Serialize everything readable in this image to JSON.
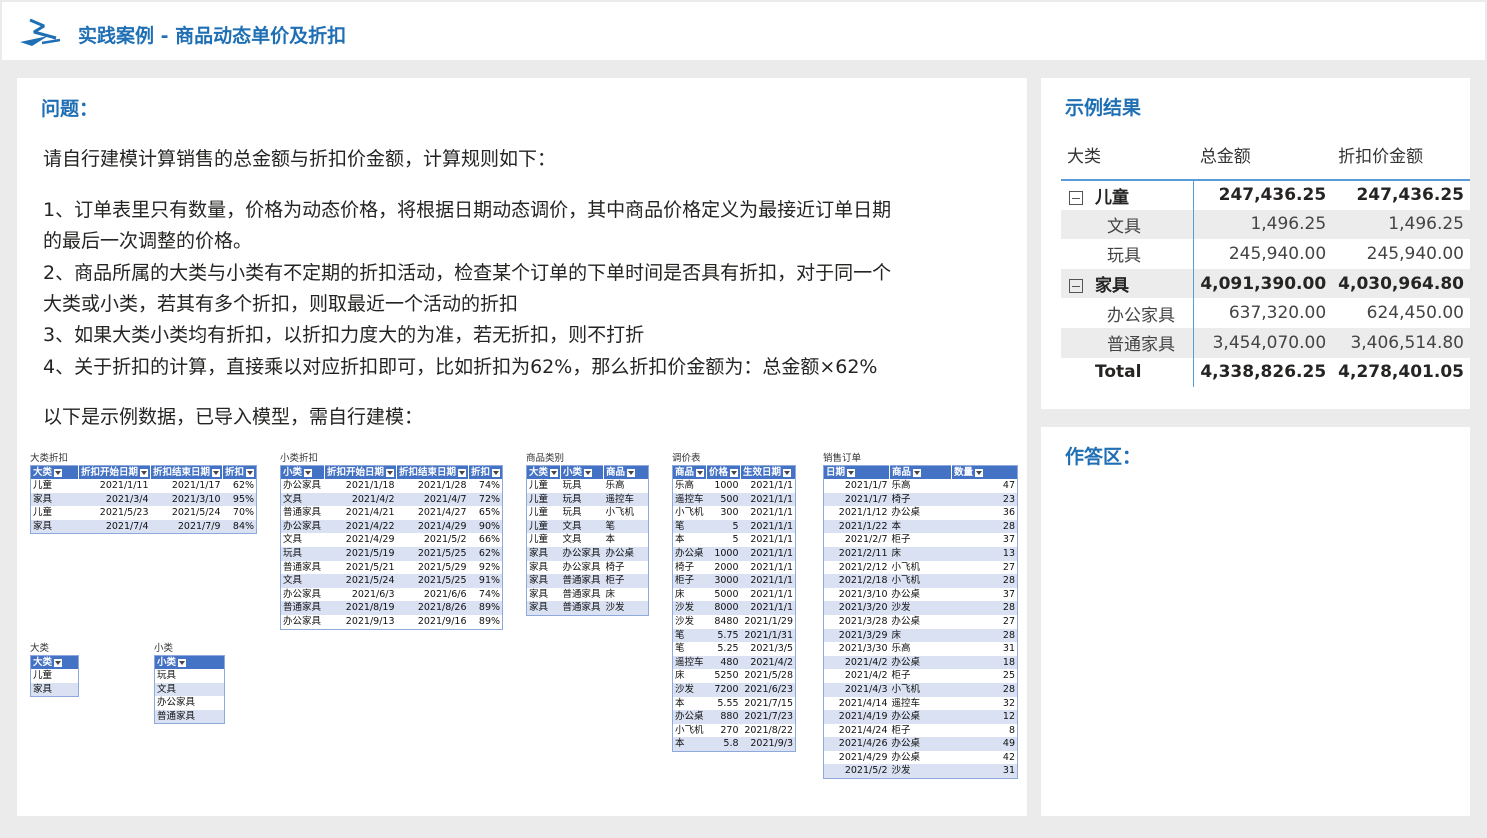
{
  "header": {
    "title": "实践案例 - 商品动态单价及折扣"
  },
  "question": {
    "heading": "问题：",
    "intro": "请自行建模计算销售的总金额与折扣价金额，计算规则如下：",
    "rules": [
      "1、订单表里只有数量，价格为动态价格，将根据日期动态调价，其中商品价格定义为最接近订单日期",
      "的最后一次调整的价格。",
      "2、商品所属的大类与小类有不定期的折扣活动，检查某个订单的下单时间是否具有折扣，对于同一个",
      "大类或小类，若其有多个折扣，则取最近一个活动的折扣",
      "3、如果大类小类均有折扣，以折扣力度大的为准，若无折扣，则不打折",
      "4、关于折扣的计算，直接乘以对应折扣即可，比如折扣为62%，那么折扣价金额为：总金额×62%"
    ],
    "data_note": "以下是示例数据，已导入模型，需自行建模："
  },
  "tables": {
    "category_discount": {
      "caption": "大类折扣",
      "headers": [
        "大类",
        "折扣开始日期",
        "折扣结束日期",
        "折扣"
      ],
      "rows": [
        [
          "儿童",
          "2021/1/11",
          "2021/1/17",
          "62%"
        ],
        [
          "家具",
          "2021/3/4",
          "2021/3/10",
          "95%"
        ],
        [
          "儿童",
          "2021/5/23",
          "2021/5/24",
          "70%"
        ],
        [
          "家具",
          "2021/7/4",
          "2021/7/9",
          "84%"
        ]
      ]
    },
    "subcategory_discount": {
      "caption": "小类折扣",
      "headers": [
        "小类",
        "折扣开始日期",
        "折扣结束日期",
        "折扣"
      ],
      "rows": [
        [
          "办公家具",
          "2021/1/18",
          "2021/1/28",
          "74%"
        ],
        [
          "文具",
          "2021/4/2",
          "2021/4/7",
          "72%"
        ],
        [
          "普通家具",
          "2021/4/21",
          "2021/4/27",
          "65%"
        ],
        [
          "办公家具",
          "2021/4/22",
          "2021/4/29",
          "90%"
        ],
        [
          "文具",
          "2021/4/29",
          "2021/5/2",
          "66%"
        ],
        [
          "玩具",
          "2021/5/19",
          "2021/5/25",
          "62%"
        ],
        [
          "普通家具",
          "2021/5/21",
          "2021/5/29",
          "92%"
        ],
        [
          "文具",
          "2021/5/24",
          "2021/5/25",
          "91%"
        ],
        [
          "办公家具",
          "2021/6/3",
          "2021/6/6",
          "74%"
        ],
        [
          "普通家具",
          "2021/8/19",
          "2021/8/26",
          "89%"
        ],
        [
          "办公家具",
          "2021/9/13",
          "2021/9/16",
          "89%"
        ]
      ]
    },
    "product_category": {
      "caption": "商品类别",
      "headers": [
        "大类",
        "小类",
        "商品"
      ],
      "rows": [
        [
          "儿童",
          "玩具",
          "乐高"
        ],
        [
          "儿童",
          "玩具",
          "遥控车"
        ],
        [
          "儿童",
          "玩具",
          "小飞机"
        ],
        [
          "儿童",
          "文具",
          "笔"
        ],
        [
          "儿童",
          "文具",
          "本"
        ],
        [
          "家具",
          "办公家具",
          "办公桌"
        ],
        [
          "家具",
          "办公家具",
          "椅子"
        ],
        [
          "家具",
          "普通家具",
          "柜子"
        ],
        [
          "家具",
          "普通家具",
          "床"
        ],
        [
          "家具",
          "普通家具",
          "沙发"
        ]
      ]
    },
    "price_adjust": {
      "caption": "调价表",
      "headers": [
        "商品",
        "价格",
        "生效日期"
      ],
      "rows": [
        [
          "乐高",
          "1000",
          "2021/1/1"
        ],
        [
          "遥控车",
          "500",
          "2021/1/1"
        ],
        [
          "小飞机",
          "300",
          "2021/1/1"
        ],
        [
          "笔",
          "5",
          "2021/1/1"
        ],
        [
          "本",
          "5",
          "2021/1/1"
        ],
        [
          "办公桌",
          "1000",
          "2021/1/1"
        ],
        [
          "椅子",
          "2000",
          "2021/1/1"
        ],
        [
          "柜子",
          "3000",
          "2021/1/1"
        ],
        [
          "床",
          "5000",
          "2021/1/1"
        ],
        [
          "沙发",
          "8000",
          "2021/1/1"
        ],
        [
          "沙发",
          "8480",
          "2021/1/29"
        ],
        [
          "笔",
          "5.75",
          "2021/1/31"
        ],
        [
          "笔",
          "5.25",
          "2021/3/5"
        ],
        [
          "遥控车",
          "480",
          "2021/4/2"
        ],
        [
          "床",
          "5250",
          "2021/5/28"
        ],
        [
          "沙发",
          "7200",
          "2021/6/23"
        ],
        [
          "本",
          "5.55",
          "2021/7/15"
        ],
        [
          "办公桌",
          "880",
          "2021/7/23"
        ],
        [
          "小飞机",
          "270",
          "2021/8/22"
        ],
        [
          "本",
          "5.8",
          "2021/9/3"
        ]
      ]
    },
    "sales_orders": {
      "caption": "销售订单",
      "headers": [
        "日期",
        "商品",
        "数量"
      ],
      "rows": [
        [
          "2021/1/7",
          "乐高",
          "47"
        ],
        [
          "2021/1/7",
          "椅子",
          "23"
        ],
        [
          "2021/1/12",
          "办公桌",
          "36"
        ],
        [
          "2021/1/22",
          "本",
          "28"
        ],
        [
          "2021/2/7",
          "柜子",
          "37"
        ],
        [
          "2021/2/11",
          "床",
          "13"
        ],
        [
          "2021/2/12",
          "小飞机",
          "27"
        ],
        [
          "2021/2/18",
          "小飞机",
          "28"
        ],
        [
          "2021/3/10",
          "办公桌",
          "37"
        ],
        [
          "2021/3/20",
          "沙发",
          "28"
        ],
        [
          "2021/3/28",
          "办公桌",
          "27"
        ],
        [
          "2021/3/29",
          "床",
          "28"
        ],
        [
          "2021/3/30",
          "乐高",
          "31"
        ],
        [
          "2021/4/2",
          "办公桌",
          "18"
        ],
        [
          "2021/4/2",
          "柜子",
          "25"
        ],
        [
          "2021/4/3",
          "小飞机",
          "28"
        ],
        [
          "2021/4/14",
          "遥控车",
          "32"
        ],
        [
          "2021/4/19",
          "办公桌",
          "12"
        ],
        [
          "2021/4/24",
          "柜子",
          "8"
        ],
        [
          "2021/4/26",
          "办公桌",
          "49"
        ],
        [
          "2021/4/29",
          "办公桌",
          "42"
        ],
        [
          "2021/5/2",
          "沙发",
          "31"
        ]
      ]
    },
    "category_list": {
      "caption": "大类",
      "headers": [
        "大类"
      ],
      "rows": [
        [
          "儿童"
        ],
        [
          "家具"
        ]
      ]
    },
    "subcategory_list": {
      "caption": "小类",
      "headers": [
        "小类"
      ],
      "rows": [
        [
          "玩具"
        ],
        [
          "文具"
        ],
        [
          "办公家具"
        ],
        [
          "普通家具"
        ]
      ]
    }
  },
  "result": {
    "heading": "示例结果",
    "columns": [
      "大类",
      "总金额",
      "折扣价金额"
    ],
    "rows": [
      {
        "type": "group",
        "label": "儿童",
        "total": "247,436.25",
        "discounted": "247,436.25"
      },
      {
        "type": "child",
        "label": "文具",
        "total": "1,496.25",
        "discounted": "1,496.25"
      },
      {
        "type": "child",
        "label": "玩具",
        "total": "245,940.00",
        "discounted": "245,940.00"
      },
      {
        "type": "group",
        "label": "家具",
        "total": "4,091,390.00",
        "discounted": "4,030,964.80"
      },
      {
        "type": "child",
        "label": "办公家具",
        "total": "637,320.00",
        "discounted": "624,450.00"
      },
      {
        "type": "child",
        "label": "普通家具",
        "total": "3,454,070.00",
        "discounted": "3,406,514.80"
      },
      {
        "type": "total",
        "label": "Total",
        "total": "4,338,826.25",
        "discounted": "4,278,401.05"
      }
    ]
  },
  "answer": {
    "heading": "作答区："
  },
  "colors": {
    "accent": "#1f6fb4",
    "table_header": "#4472c4",
    "table_band": "#d9e1f2"
  },
  "icons": {
    "logo": "lightning-logo-icon",
    "expand": "collapse-minus-icon"
  }
}
